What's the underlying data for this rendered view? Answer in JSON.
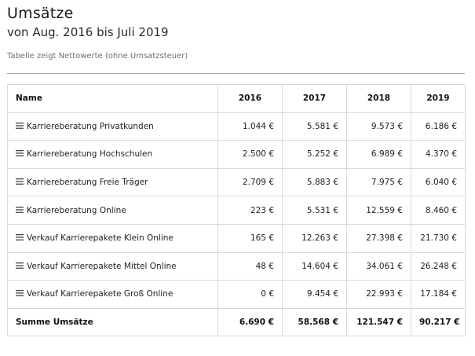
{
  "header": {
    "title": "Umsätze",
    "subtitle": "von Aug. 2016 bis Juli 2019",
    "note": "Tabelle zeigt Nettowerte (ohne Umsatzsteuer)"
  },
  "table": {
    "columns": [
      "Name",
      "2016",
      "2017",
      "2018",
      "2019"
    ],
    "rows": [
      {
        "name": "Karriereberatung Privatkunden",
        "values": [
          "1.044 €",
          "5.581 €",
          "9.573 €",
          "6.186 €"
        ]
      },
      {
        "name": "Karriereberatung Hochschulen",
        "values": [
          "2.500 €",
          "5.252 €",
          "6.989 €",
          "4.370 €"
        ]
      },
      {
        "name": "Karriereberatung Freie Träger",
        "values": [
          "2.709 €",
          "5.883 €",
          "7.975 €",
          "6.040 €"
        ]
      },
      {
        "name": "Karriereberatung Online",
        "values": [
          "223 €",
          "5.531 €",
          "12.559 €",
          "8.460 €"
        ]
      },
      {
        "name": "Verkauf Karrierepakete Klein Online",
        "values": [
          "165 €",
          "12.263 €",
          "27.398 €",
          "21.730 €"
        ]
      },
      {
        "name": "Verkauf Karrierepakete Mittel Online",
        "values": [
          "48 €",
          "14.604 €",
          "34.061 €",
          "26.248 €"
        ]
      },
      {
        "name": "Verkauf Karrierepakete Groß Online",
        "values": [
          "0 €",
          "9.454 €",
          "22.993 €",
          "17.184 €"
        ]
      }
    ],
    "total": {
      "name": "Summe Umsätze",
      "values": [
        "6.690 €",
        "58.568 €",
        "121.547 €",
        "90.217 €"
      ]
    },
    "row_icon": "drag-handle-icon"
  }
}
